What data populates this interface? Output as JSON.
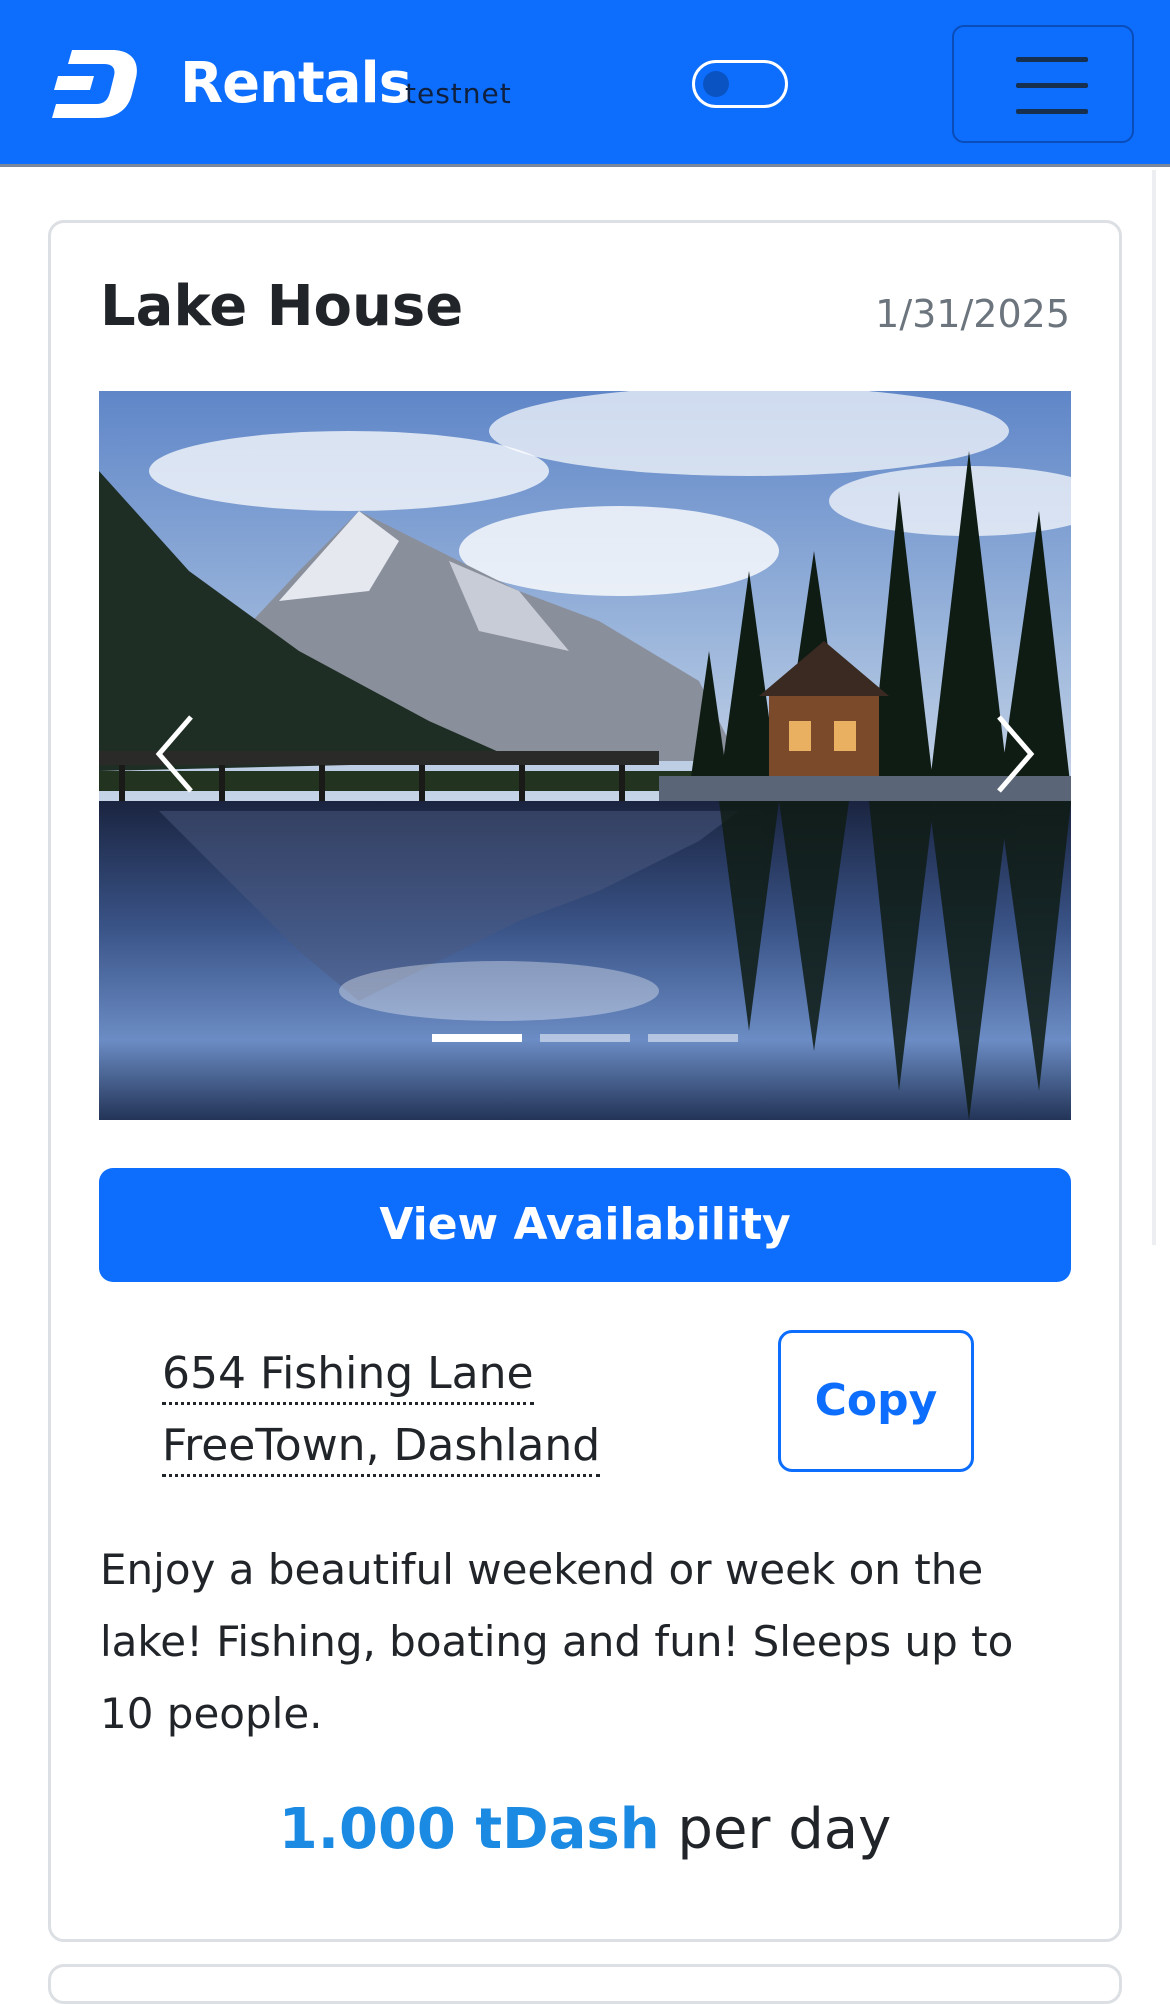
{
  "navbar": {
    "brand": "Rentals",
    "network": "testnet",
    "logo_icon": "dash-logo-icon",
    "menu_icon": "hamburger-menu-icon",
    "accent_color": "#0d6efd"
  },
  "listing": {
    "title": "Lake House",
    "date": "1/31/2025",
    "carousel": {
      "prev_icon": "chevron-left-icon",
      "next_icon": "chevron-right-icon",
      "slide_count": 3,
      "active_slide": 1
    },
    "view_availability_label": "View Availability",
    "address_line1": "654 Fishing Lane",
    "address_line2": "FreeTown, Dashland",
    "copy_label": "Copy",
    "description": "Enjoy a beautiful weekend or week on the lake! Fishing, boating and fun! Sleeps up to 10 people.",
    "price_amount": "1.000 tDash",
    "price_unit": "per day"
  }
}
